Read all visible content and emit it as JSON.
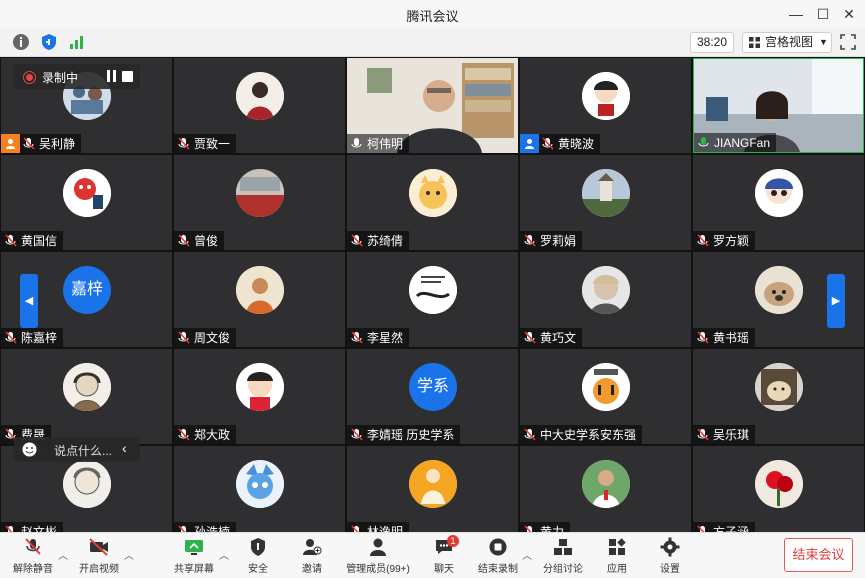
{
  "window": {
    "title": "腾讯会议"
  },
  "toolbar": {
    "timer": "38:20",
    "view_label": "宫格视图"
  },
  "recording": {
    "label": "录制中"
  },
  "chat": {
    "placeholder": "说点什么..."
  },
  "participants": [
    {
      "name": "吴利静",
      "avatar": "illustration",
      "badge": "cohost"
    },
    {
      "name": "贾致一",
      "avatar": "portrait"
    },
    {
      "name": "柯伟明",
      "avatar": "video"
    },
    {
      "name": "黄晓波",
      "avatar": "cartoon",
      "badge": "host"
    },
    {
      "name": "JIANGFan",
      "avatar": "video",
      "speaking": true
    },
    {
      "name": "黄国信",
      "avatar": "lion-dance"
    },
    {
      "name": "曾俊",
      "avatar": "theater"
    },
    {
      "name": "苏绮倩",
      "avatar": "cat"
    },
    {
      "name": "罗莉娟",
      "avatar": "castle"
    },
    {
      "name": "罗方颖",
      "avatar": "cartoon-boy"
    },
    {
      "name": "陈嘉梓",
      "avatar_text": "嘉梓"
    },
    {
      "name": "周文俊",
      "avatar": "painting"
    },
    {
      "name": "李星然",
      "avatar": "calligraphy"
    },
    {
      "name": "黄巧文",
      "avatar": "child-photo"
    },
    {
      "name": "黄书瑶",
      "avatar": "dog"
    },
    {
      "name": "费晟",
      "avatar": "sketch"
    },
    {
      "name": "郑大政",
      "avatar": "cartoon-man"
    },
    {
      "name": "李婧瑶 历史学系",
      "avatar_text": "学系"
    },
    {
      "name": "中大史学系安东强",
      "avatar": "tiger"
    },
    {
      "name": "吴乐琪",
      "avatar": "cat-photo"
    },
    {
      "name": "赵文彬",
      "avatar": "sketch-man"
    },
    {
      "name": "孙浩楠",
      "avatar": "cartoon-fox"
    },
    {
      "name": "林逸明",
      "avatar": "buddha"
    },
    {
      "name": "黄力",
      "avatar": "person-photo"
    },
    {
      "name": "方子涵",
      "avatar": "flower"
    }
  ],
  "bottombar": {
    "mute": "解除静音",
    "video": "开启视频",
    "share": "共享屏幕",
    "security": "安全",
    "invite": "邀请",
    "members": "管理成员(99+)",
    "chat": "聊天",
    "chat_badge": "1",
    "record": "结束录制",
    "breakout": "分组讨论",
    "apps": "应用",
    "settings": "设置",
    "end": "结束会议"
  }
}
